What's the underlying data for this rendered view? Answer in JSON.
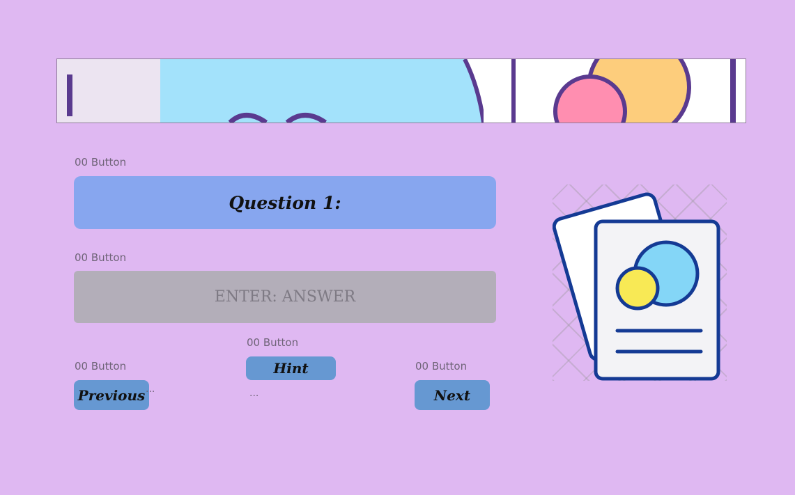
{
  "banner": {
    "description_icons": [
      "header-decoration-icon"
    ]
  },
  "question_section": {
    "caption": "00 Button",
    "question_label": "Question 1:"
  },
  "answer_section": {
    "caption": "00 Button",
    "placeholder": "ENTER: ANSWER"
  },
  "navigation": {
    "previous": {
      "caption": "00 Button",
      "label": "Previous",
      "dots": "..."
    },
    "hint": {
      "caption": "00 Button",
      "label": "Hint",
      "dots": "..."
    },
    "next": {
      "caption": "00 Button",
      "label": "Next"
    }
  },
  "illustration": {
    "icon": "document-cards-icon"
  },
  "colors": {
    "background": "#dfb8f2",
    "question_box": "#87a6ef",
    "answer_box": "#b3aeb9",
    "nav_button": "#6698d2"
  }
}
